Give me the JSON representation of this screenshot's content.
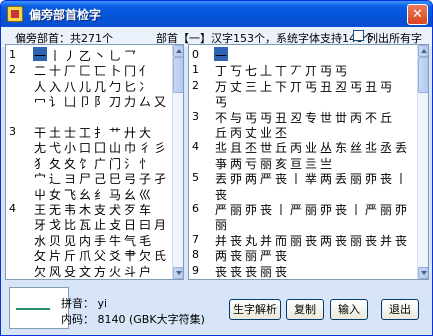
{
  "window": {
    "title": "偏旁部首检字"
  },
  "info": {
    "radical_count": "偏旁部首：共271个",
    "radical_summary": "部首【一】汉字153个，系统字体支持148个",
    "show_all_label": "列出所有字"
  },
  "radicals_panel": {
    "rows": [
      {
        "num": "1",
        "chars": "一丨丿乙丶乚乛"
      },
      {
        "num": "2",
        "chars": "二十厂匚匸卜冂亻"
      },
      {
        "num": "",
        "chars": "人入八儿几勹匕冫"
      },
      {
        "num": "",
        "chars": "冖讠凵卩阝刀力厶又"
      },
      {
        "num": "",
        "chars": ""
      },
      {
        "num": "3",
        "chars": "干土士工扌艹廾大"
      },
      {
        "num": "",
        "chars": "尢弋小口囗山巾彳彡"
      },
      {
        "num": "",
        "chars": "犭夂夊饣广门氵忄"
      },
      {
        "num": "",
        "chars": "宀辶ヨ尸己巳弓子孑"
      },
      {
        "num": "",
        "chars": "屮女飞幺纟马幺巛"
      },
      {
        "num": "4",
        "chars": "王无韦木支犬歹车"
      },
      {
        "num": "",
        "chars": "牙戈比瓦止攴日曰月"
      },
      {
        "num": "",
        "chars": "水贝见内手牛气毛"
      },
      {
        "num": "",
        "chars": "攵片斤爪父爻肀欠氏"
      },
      {
        "num": "",
        "chars": "欠风殳文方火斗户"
      }
    ]
  },
  "chars_panel": {
    "selected": "一",
    "rows": [
      {
        "num": "0",
        "chars": "一"
      },
      {
        "num": "1",
        "chars": "丁丂七丄丅丆丌丏丐"
      },
      {
        "num": "2",
        "chars": "万丈三上下丌丐丑丒丐丑丏"
      },
      {
        "num": "",
        "chars": "丐"
      },
      {
        "num": "3",
        "chars": "不与丐丏丑丒专世丗丙不丘"
      },
      {
        "num": "",
        "chars": "丘丙丈业丕"
      },
      {
        "num": "4",
        "chars": "丠且丕世丘丙业丛东丝丠丞丢"
      },
      {
        "num": "",
        "chars": "亊两亏丽亥亘亖亗"
      },
      {
        "num": "5",
        "chars": "丟丣两严丧丨丵两丢丽丣丧丨"
      },
      {
        "num": "",
        "chars": "丧"
      },
      {
        "num": "6",
        "chars": "严丽丣丧丨严丽丣丧丨严丽丣"
      },
      {
        "num": "",
        "chars": "丽"
      },
      {
        "num": "7",
        "chars": "并丧丸并而丽丧两丧丽丧并丧"
      },
      {
        "num": "8",
        "chars": "两丧丽严丧"
      },
      {
        "num": "9",
        "chars": "丧丧丧丽丧"
      }
    ]
  },
  "bottom": {
    "pinyin_label": "拼音：",
    "pinyin_value": "yi",
    "code_label": "内码：",
    "code_value": "8140 (GBK大字符集)"
  },
  "buttons": {
    "analyze": "生字解析",
    "copy": "复制",
    "input": "输入",
    "exit": "退出"
  }
}
